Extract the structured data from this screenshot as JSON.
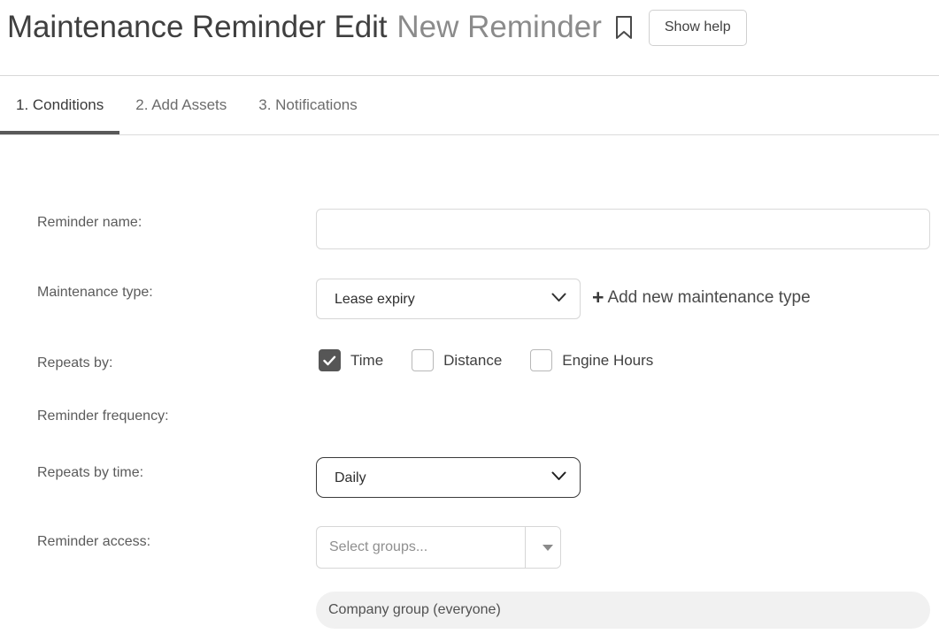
{
  "header": {
    "title_main": "Maintenance Reminder Edit",
    "title_sub": "New Reminder",
    "bookmark_icon": "bookmark-icon",
    "show_help_label": "Show help"
  },
  "tabs": [
    {
      "label": "1. Conditions",
      "active": true
    },
    {
      "label": "2. Add Assets",
      "active": false
    },
    {
      "label": "3. Notifications",
      "active": false
    }
  ],
  "form": {
    "reminder_name": {
      "label": "Reminder name:",
      "value": "",
      "placeholder": ""
    },
    "maintenance_type": {
      "label": "Maintenance type:",
      "selected": "Lease expiry",
      "options": [
        "Lease expiry"
      ],
      "chevron_icon": "chevron-down-icon",
      "add_link": {
        "plus_icon": "plus-icon",
        "label": "Add new maintenance type"
      }
    },
    "repeats_by": {
      "label": "Repeats by:",
      "options": [
        {
          "label": "Time",
          "checked": true
        },
        {
          "label": "Distance",
          "checked": false
        },
        {
          "label": "Engine Hours",
          "checked": false
        }
      ],
      "check_icon": "check-icon"
    },
    "reminder_frequency": {
      "label": "Reminder frequency:"
    },
    "repeats_by_time": {
      "label": "Repeats by time:",
      "selected": "Daily",
      "options": [
        "Daily"
      ],
      "chevron_icon": "chevron-down-icon"
    },
    "reminder_access": {
      "label": "Reminder access:",
      "placeholder": "Select groups...",
      "value": "",
      "caret_icon": "caret-down-icon",
      "selected_group": "Company group (everyone)"
    }
  },
  "colors": {
    "accent_underline": "#595959",
    "checkbox_checked": "#565656",
    "border_light": "#d9d9d9",
    "border_dark": "#3a3a3a",
    "pill_bg": "#f1f1f1",
    "text_primary": "#3c3c3c",
    "text_muted": "#8b8b8b"
  }
}
